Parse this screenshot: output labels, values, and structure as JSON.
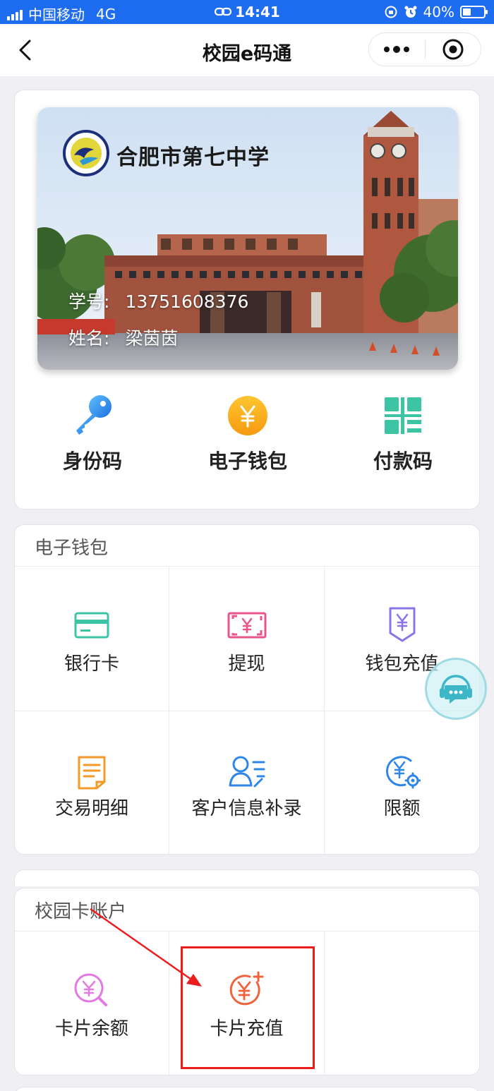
{
  "status_bar": {
    "carrier": "中国移动",
    "network": "4G",
    "time": "14:41",
    "battery": "40%",
    "battery_level": 0.4
  },
  "nav": {
    "title": "校园e码通"
  },
  "campus_card": {
    "school_name": "合肥市第七中学",
    "student_id_label": "学号:",
    "student_id": "13751608376",
    "name_label": "姓名:",
    "name": "梁茵茵"
  },
  "quick_actions": [
    {
      "label": "身份码",
      "icon": "key-icon"
    },
    {
      "label": "电子钱包",
      "icon": "yuan-coin-icon"
    },
    {
      "label": "付款码",
      "icon": "qr-code-icon"
    }
  ],
  "wallet_section": {
    "title": "电子钱包",
    "items": [
      {
        "label": "银行卡",
        "icon": "bank-card-icon"
      },
      {
        "label": "提现",
        "icon": "withdraw-icon"
      },
      {
        "label": "钱包充值",
        "icon": "wallet-recharge-icon"
      },
      {
        "label": "交易明细",
        "icon": "transaction-detail-icon"
      },
      {
        "label": "客户信息补录",
        "icon": "user-info-edit-icon"
      },
      {
        "label": "限额",
        "icon": "limit-settings-icon"
      }
    ]
  },
  "campus_account_section": {
    "title": "校园卡账户",
    "items": [
      {
        "label": "卡片余额",
        "icon": "card-balance-icon"
      },
      {
        "label": "卡片充值",
        "icon": "card-recharge-icon"
      }
    ]
  },
  "colors": {
    "status_bar": "#1e6df0",
    "highlight_box": "#ee1d1d",
    "wallet_icon_green": "#3cc4a4",
    "wallet_icon_pink": "#e8568c",
    "wallet_icon_purple": "#8a74e6",
    "wallet_icon_orange": "#f39a2a",
    "wallet_icon_blue": "#2f86e8",
    "recharge_orange": "#f0633c"
  }
}
